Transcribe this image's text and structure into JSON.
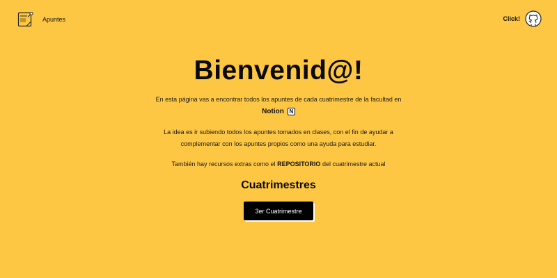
{
  "header": {
    "brand_label": "Apuntes",
    "brand_icon": "notepad-icon",
    "click_label": "Click!",
    "github_icon": "github-icon"
  },
  "main": {
    "title": "Bienvenid@!",
    "intro_line1": "En esta página vas a encontrar todos los apuntes de cada cuatrimestre de la facultad en",
    "notion_label": "Notion",
    "notion_icon_glyph": "N",
    "idea_line1": "La idea es ir subiendo todos los apuntes tomados en clases, con el fin de ayudar a",
    "idea_line2": "complementar con los apuntes propios como una ayuda para estudiar.",
    "extras_prefix": "También hay recursos extras como el",
    "extras_strong": "REPOSITORIO",
    "extras_suffix": "del cuatrimestre actual",
    "subtitle": "Cuatrimestres",
    "term_button": "3er Cuatrimestre"
  },
  "colors": {
    "background": "#fec743",
    "button_bg": "#000000",
    "button_text": "#ffffff",
    "text": "#111111"
  }
}
